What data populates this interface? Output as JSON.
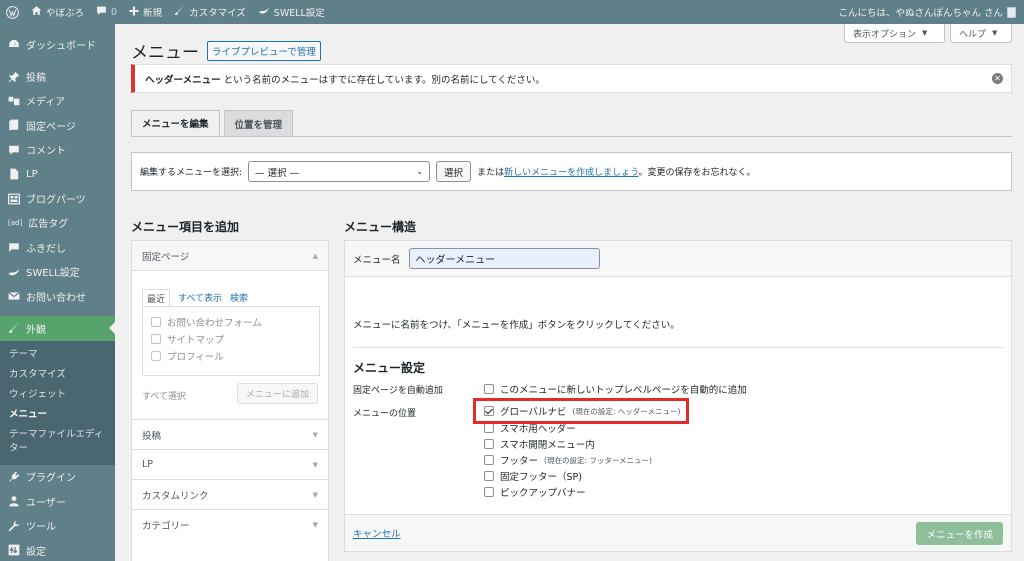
{
  "adminbar": {
    "site_name": "やぼぶろ",
    "comments_count": "0",
    "new_label": "新規",
    "customize_label": "カスタマイズ",
    "swell_label": "SWELL設定",
    "greeting": "こんにちは、やぬさんぽんちゃん さん"
  },
  "sidebar": {
    "items": [
      {
        "label": "ダッシュボード",
        "icon": "dashboard-icon"
      },
      {
        "label": "投稿",
        "icon": "pin-icon"
      },
      {
        "label": "メディア",
        "icon": "media-icon"
      },
      {
        "label": "固定ページ",
        "icon": "page-icon"
      },
      {
        "label": "コメント",
        "icon": "comment-icon"
      },
      {
        "label": "LP",
        "icon": "document-icon"
      },
      {
        "label": "ブログパーツ",
        "icon": "blocks-icon"
      },
      {
        "label": "広告タグ",
        "icon": "ad-icon"
      },
      {
        "label": "ふきだし",
        "icon": "balloon-icon"
      },
      {
        "label": "SWELL設定",
        "icon": "swell-icon"
      },
      {
        "label": "お問い合わせ",
        "icon": "mail-icon"
      },
      {
        "label": "外観",
        "icon": "brush-icon"
      }
    ],
    "submenu": [
      "テーマ",
      "カスタマイズ",
      "ウィジェット",
      "メニュー",
      "テーマファイルエディター"
    ],
    "bottom_items": [
      {
        "label": "プラグイン",
        "icon": "plugin-icon"
      },
      {
        "label": "ユーザー",
        "icon": "user-icon"
      },
      {
        "label": "ツール",
        "icon": "wrench-icon"
      },
      {
        "label": "設定",
        "icon": "settings-icon"
      }
    ]
  },
  "top_buttons": {
    "screen_options": "表示オプション",
    "help": "ヘルプ"
  },
  "page": {
    "title": "メニュー",
    "live_preview": "ライブプレビューで管理"
  },
  "notice": {
    "bold": "ヘッダーメニュー",
    "text": "という名前のメニューはすでに存在しています。別の名前にしてください。"
  },
  "tabs": [
    "メニューを編集",
    "位置を管理"
  ],
  "select_menu": {
    "label": "編集するメニューを選択:",
    "value": "— 選択 —",
    "button": "選択",
    "or": "または",
    "create_link": "新しいメニューを作成しましょう",
    "suffix": "。変更の保存をお忘れなく。"
  },
  "add_items": {
    "title": "メニュー項目を追加",
    "section_pages": "固定ページ",
    "inner_tabs": [
      "最近",
      "すべて表示",
      "検索"
    ],
    "pages": [
      "お問い合わせフォーム",
      "サイトマップ",
      "プロフィール"
    ],
    "select_all": "すべて選択",
    "add_button": "メニューに追加",
    "sections": [
      "投稿",
      "LP",
      "カスタムリンク",
      "カテゴリー"
    ]
  },
  "structure": {
    "title": "メニュー構造",
    "name_label": "メニュー名",
    "name_value": "ヘッダーメニュー",
    "instructions": "メニューに名前をつけ、「メニューを作成」ボタンをクリックしてください。",
    "settings_title": "メニュー設定",
    "auto_add_label": "固定ページを自動追加",
    "auto_add_option": "このメニューに新しいトップレベルページを自動的に追加",
    "position_label": "メニューの位置",
    "positions": [
      {
        "label": "グローバルナビ",
        "note": "(現在の設定: ヘッダーメニュー)",
        "checked": true
      },
      {
        "label": "スマホ用ヘッダー",
        "note": "",
        "checked": false
      },
      {
        "label": "スマホ開閉メニュー内",
        "note": "",
        "checked": false
      },
      {
        "label": "フッター",
        "note": "(現在の設定: フッターメニュー)",
        "checked": false
      },
      {
        "label": "固定フッター（SP)",
        "note": "",
        "checked": false
      },
      {
        "label": "ピックアップバナー",
        "note": "",
        "checked": false
      }
    ],
    "cancel": "キャンセル",
    "create_button": "メニューを作成"
  },
  "colors": {
    "admin_bg": "#5f7f89",
    "current_menu": "#56a36b",
    "notice_border": "#d63638",
    "highlight": "#e22b2b",
    "primary_button": "#8fbf9a"
  }
}
